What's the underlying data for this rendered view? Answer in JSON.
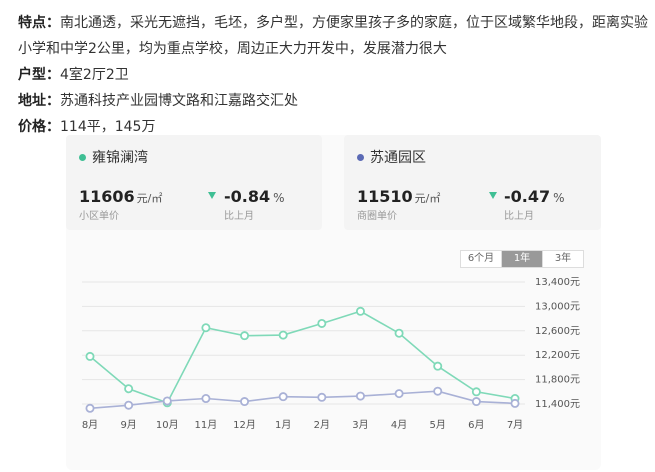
{
  "info": {
    "features_label": "特点：",
    "features_text": "南北通透，采光无遮挡，毛坯，多户型，方便家里孩子多的家庭，位于区域繁华地段，距离实验小学和中学2公里，均为重点学校，周边正大力开发中，发展潜力很大",
    "layout_label": "户型：",
    "layout_text": "4室2厅2卫",
    "address_label": "地址：",
    "address_text": "苏通科技产业园博文路和江嘉路交汇处",
    "price_label": "价格：",
    "price_text": "114平，145万"
  },
  "cards": [
    {
      "name": "雍锦澜湾",
      "price": "11606",
      "unit": "元/㎡",
      "price_label": "小区单价",
      "change": "-0.84",
      "change_unit": "%",
      "change_label": "比上月",
      "dot_color": "#3fbf94"
    },
    {
      "name": "苏通园区",
      "price": "11510",
      "unit": "元/㎡",
      "price_label": "商圈单价",
      "change": "-0.47",
      "change_unit": "%",
      "change_label": "比上月",
      "dot_color": "#5b6ab5"
    }
  ],
  "tabs": [
    {
      "label": "6个月",
      "active": false
    },
    {
      "label": "1年",
      "active": true
    },
    {
      "label": "3年",
      "active": false
    }
  ],
  "colors": {
    "series1": "#7fd9b8",
    "series1_marker": "#3fbf94",
    "series2": "#a9b1d6",
    "series2_marker": "#5b6ab5",
    "grid": "#e6e6e6"
  },
  "chart_data": {
    "type": "line",
    "categories": [
      "8月",
      "9月",
      "10月",
      "11月",
      "12月",
      "1月",
      "2月",
      "3月",
      "4月",
      "5月",
      "6月",
      "7月"
    ],
    "y_ticks": [
      "11,400元",
      "11,800元",
      "12,200元",
      "12,600元",
      "13,000元",
      "13,400元"
    ],
    "ylim": [
      11200,
      13400
    ],
    "grid": true,
    "series": [
      {
        "name": "雍锦澜湾",
        "values": [
          12180,
          11650,
          11420,
          12650,
          12520,
          12530,
          12720,
          12920,
          12560,
          12020,
          11600,
          11490
        ]
      },
      {
        "name": "苏通园区",
        "values": [
          11330,
          11380,
          11450,
          11490,
          11440,
          11520,
          11510,
          11530,
          11570,
          11610,
          11440,
          11410
        ]
      }
    ]
  }
}
